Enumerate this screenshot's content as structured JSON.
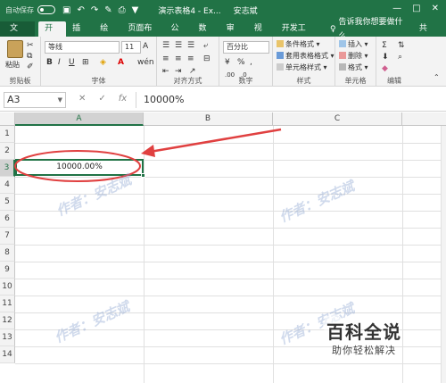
{
  "titlebar": {
    "autosave": "自动保存",
    "doc_title": "演示表格4 - Ex...",
    "user": "安志斌",
    "window_buttons": [
      "—",
      "□",
      "✕"
    ]
  },
  "tabs": [
    "文件",
    "开始",
    "插入",
    "绘图",
    "页面布局",
    "公式",
    "数据",
    "审阅",
    "视图",
    "开发工具"
  ],
  "tell_me": "告诉我你想要做什么",
  "share": "共享",
  "ribbon": {
    "paste": "粘贴",
    "font_name": "等线",
    "font_size": "11",
    "number_format": "百分比",
    "cond_format": "条件格式",
    "table_format": "套用表格格式",
    "cell_style": "单元格样式",
    "insert": "插入",
    "delete": "删除",
    "format": "格式",
    "groups": {
      "clipboard": "剪贴板",
      "font": "字体",
      "align": "对齐方式",
      "number": "数字",
      "style": "样式",
      "cells": "单元格",
      "edit": "编辑"
    }
  },
  "formula_bar": {
    "name_box": "A3",
    "cancel": "✕",
    "confirm": "✓",
    "fx": "fx",
    "value": "10000%"
  },
  "grid": {
    "columns": [
      "A",
      "B",
      "C"
    ],
    "rows": [
      "1",
      "2",
      "3",
      "4",
      "5",
      "6",
      "7",
      "8",
      "9",
      "10",
      "11",
      "12",
      "13",
      "14"
    ],
    "a3_value": "10000.00%"
  },
  "watermark": "作者：安志斌",
  "logo": {
    "main": "百科全说",
    "sub": "助你轻松解决"
  },
  "colors": {
    "excel_green": "#217346",
    "annotation_red": "#e04040"
  }
}
